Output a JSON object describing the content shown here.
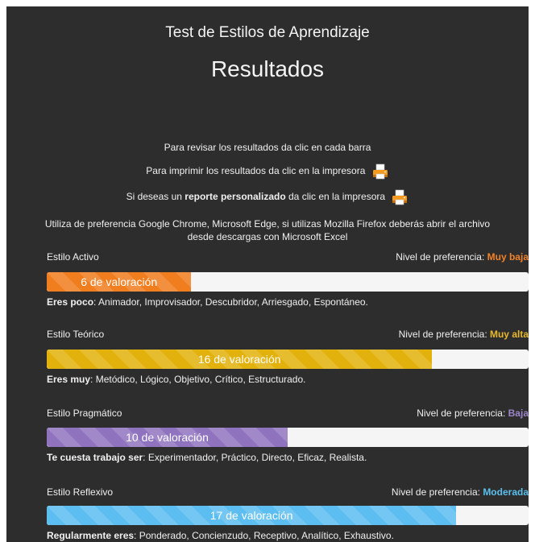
{
  "header": {
    "app_title": "Test de Estilos de Aprendizaje",
    "page_title": "Resultados"
  },
  "info": {
    "review": "Para revisar los resultados da clic en cada barra",
    "print": "Para imprimir los resultados da clic en la impresora",
    "report_pre": "Si deseas un ",
    "report_bold": "reporte personalizado",
    "report_post": " da clic en la impresora",
    "browser_note": "Utiliza de preferencia Google Chrome, Microsoft Edge, si utilizas Mozilla Firefox deberás abrir el archivo desde descargas con Microsoft Excel"
  },
  "level_label": "Nivel de preferencia: ",
  "max_score": 20,
  "styles": [
    {
      "name": "Estilo Activo",
      "level": "Muy baja",
      "level_color": "#f0832a",
      "score": 6,
      "bar_label": "6 de valoración",
      "bar_color": "#f07d1e",
      "desc_bold": "Eres poco",
      "desc_text": ": Animador, Improvisador, Descubridor, Arriesgado, Espontáneo."
    },
    {
      "name": "Estilo Teórico",
      "level": "Muy alta",
      "level_color": "#e8b82c",
      "score": 16,
      "bar_label": "16 de valoración",
      "bar_color": "#e3b10c",
      "desc_bold": "Eres muy",
      "desc_text": ": Metódico, Lógico, Objetivo, Crítico, Estructurado."
    },
    {
      "name": "Estilo Pragmático",
      "level": "Baja",
      "level_color": "#9b86c8",
      "score": 10,
      "bar_label": "10 de valoración",
      "bar_color": "#8f73bf",
      "desc_bold": "Te cuesta trabajo ser",
      "desc_text": ": Experimentador, Práctico, Directo, Eficaz, Realista."
    },
    {
      "name": "Estilo Reflexivo",
      "level": "Moderada",
      "level_color": "#5bc0ef",
      "score": 17,
      "bar_label": "17 de valoración",
      "bar_color": "#5bbdf0",
      "desc_bold": "Regularmente eres",
      "desc_text": ": Ponderado, Concienzudo, Receptivo, Analítico, Exhaustivo."
    }
  ]
}
